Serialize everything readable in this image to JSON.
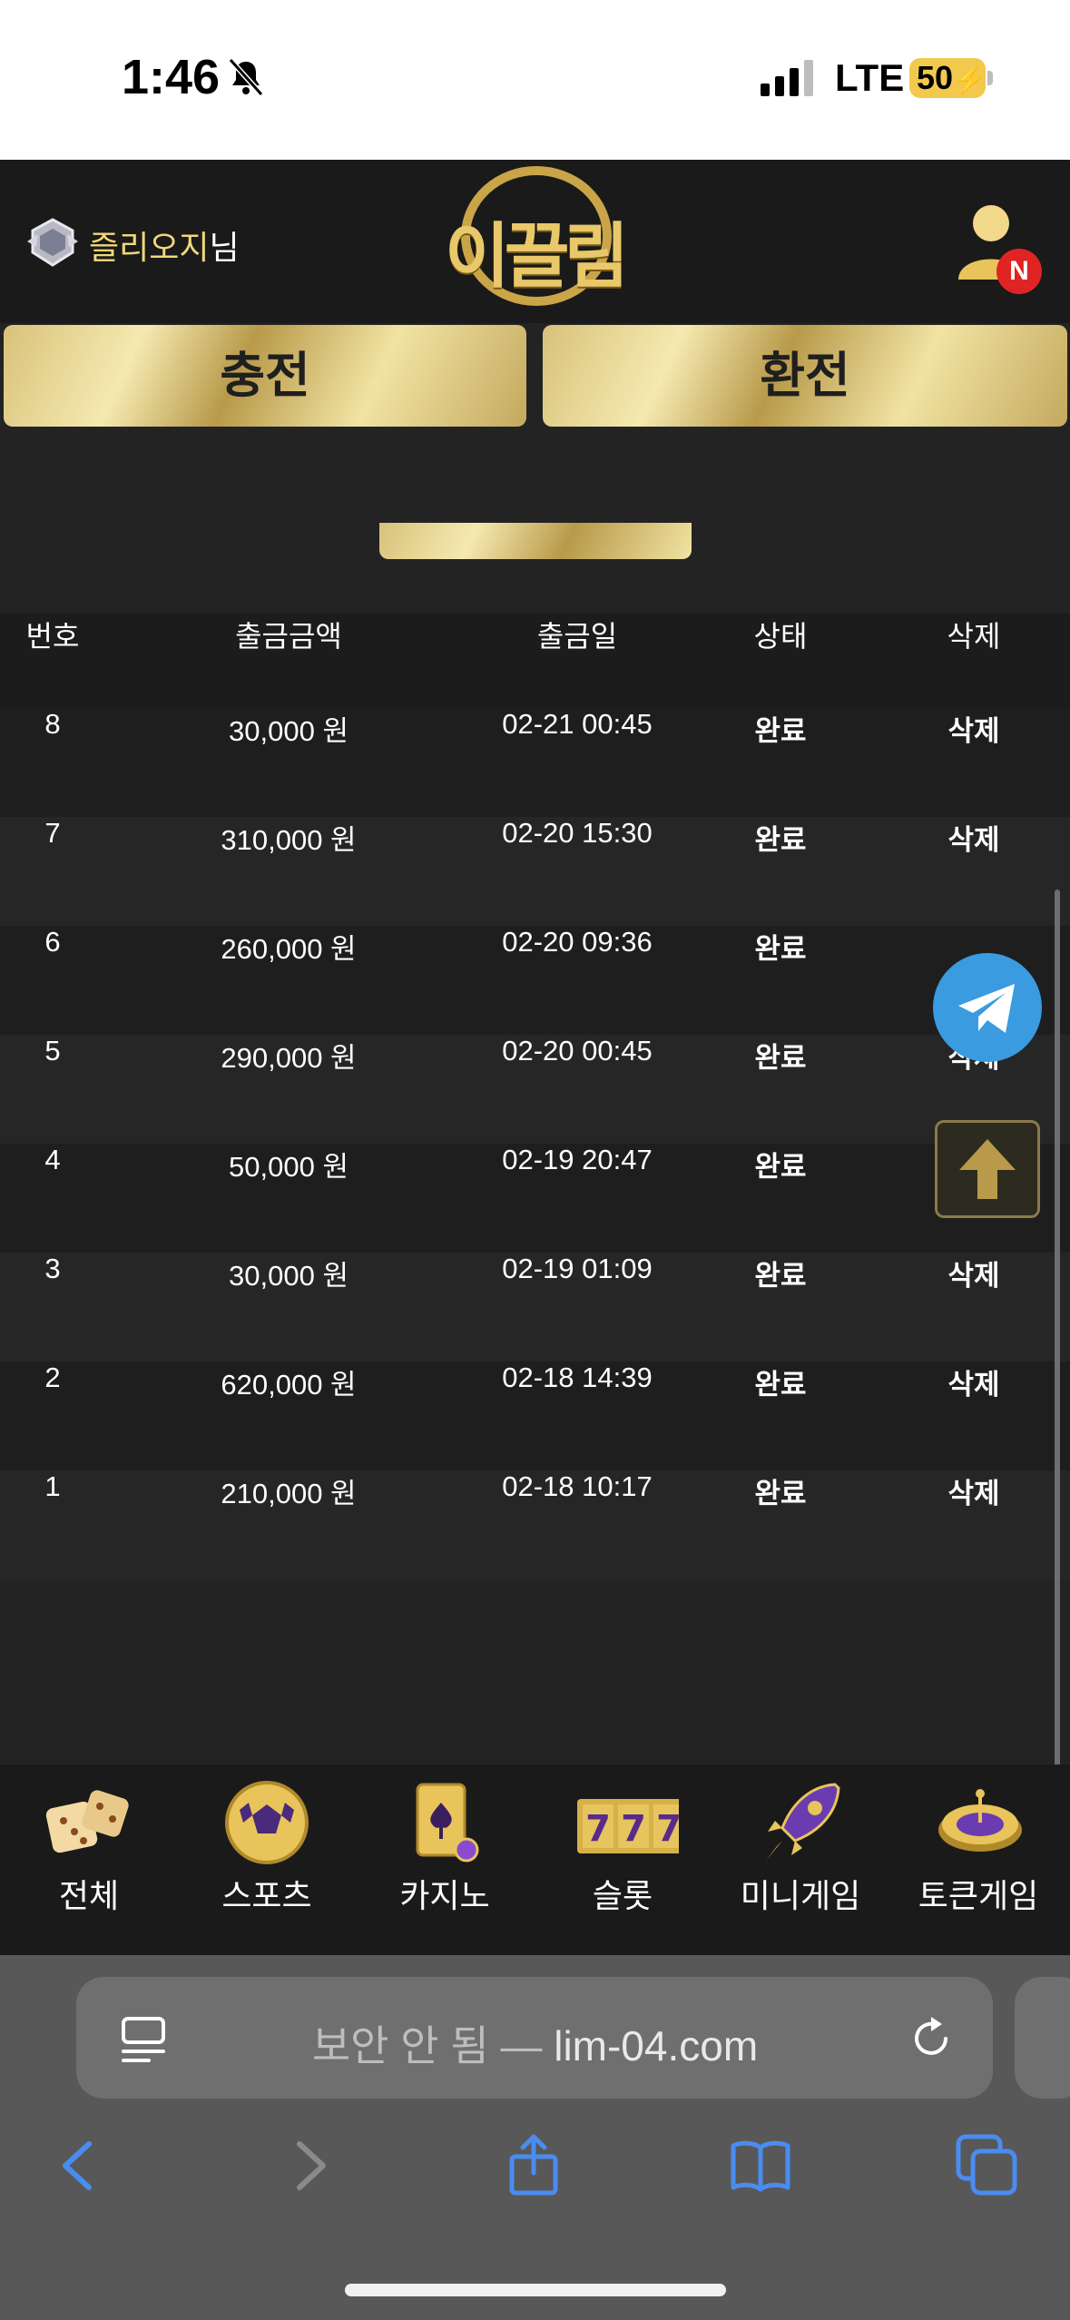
{
  "status_bar": {
    "time": "1:46",
    "network": "LTE",
    "battery": "50"
  },
  "header": {
    "username": "즐리오지",
    "username_suffix": "님",
    "logo_text": "이끌림",
    "notification_badge": "N"
  },
  "actions": {
    "deposit_label": "충전",
    "withdraw_label": "환전"
  },
  "table": {
    "headers": [
      "번호",
      "출금금액",
      "출금일",
      "상태",
      "삭제"
    ],
    "rows": [
      {
        "no": "8",
        "amount": "30,000 원",
        "date": "02-21 00:45",
        "status": "완료",
        "delete": "삭제"
      },
      {
        "no": "7",
        "amount": "310,000 원",
        "date": "02-20 15:30",
        "status": "완료",
        "delete": "삭제"
      },
      {
        "no": "6",
        "amount": "260,000 원",
        "date": "02-20 09:36",
        "status": "완료",
        "delete": ""
      },
      {
        "no": "5",
        "amount": "290,000 원",
        "date": "02-20 00:45",
        "status": "완료",
        "delete": "삭제"
      },
      {
        "no": "4",
        "amount": "50,000 원",
        "date": "02-19 20:47",
        "status": "완료",
        "delete": ""
      },
      {
        "no": "3",
        "amount": "30,000 원",
        "date": "02-19 01:09",
        "status": "완료",
        "delete": "삭제"
      },
      {
        "no": "2",
        "amount": "620,000 원",
        "date": "02-18 14:39",
        "status": "완료",
        "delete": "삭제"
      },
      {
        "no": "1",
        "amount": "210,000 원",
        "date": "02-18 10:17",
        "status": "완료",
        "delete": "삭제"
      }
    ]
  },
  "bottom_nav": [
    {
      "label": "전체",
      "icon": "dice-icon"
    },
    {
      "label": "스포츠",
      "icon": "soccer-ball-icon"
    },
    {
      "label": "카지노",
      "icon": "playing-cards-icon"
    },
    {
      "label": "슬롯",
      "icon": "slot-777-icon"
    },
    {
      "label": "미니게임",
      "icon": "rocket-icon"
    },
    {
      "label": "토큰게임",
      "icon": "roulette-icon"
    }
  ],
  "browser": {
    "insecure_label": "보안 안 됨 —",
    "domain": "lim-04.com"
  },
  "colors": {
    "gold": "#e8c86a",
    "accent_red": "#e02424",
    "telegram_blue": "#3a9be0",
    "ios_blue": "#4a8cf0"
  }
}
